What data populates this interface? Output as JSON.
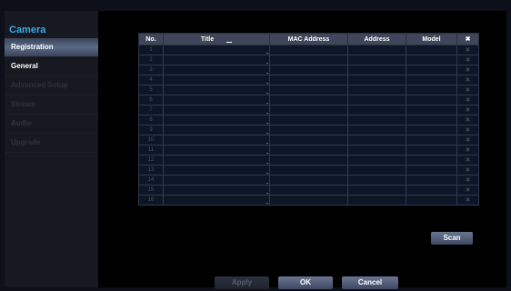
{
  "sidebar": {
    "title": "Camera",
    "items": [
      {
        "label": "Registration",
        "state": "active"
      },
      {
        "label": "General",
        "state": "enabled"
      },
      {
        "label": "Advanced Setup",
        "state": "disabled"
      },
      {
        "label": "Stream",
        "state": "disabled"
      },
      {
        "label": "Audio",
        "state": "disabled"
      },
      {
        "label": "Upgrade",
        "state": "disabled"
      }
    ]
  },
  "table": {
    "headers": {
      "no": "No.",
      "title": "Title",
      "mac": "MAC Address",
      "address": "Address",
      "model": "Model",
      "delete_icon": "✖"
    },
    "rows": [
      "1",
      "2",
      "3",
      "4",
      "5",
      "6",
      "7",
      "8",
      "9",
      "10",
      "11",
      "12",
      "13",
      "14",
      "15",
      "16"
    ]
  },
  "buttons": {
    "scan": "Scan",
    "apply": "Apply",
    "ok": "OK",
    "cancel": "Cancel"
  }
}
